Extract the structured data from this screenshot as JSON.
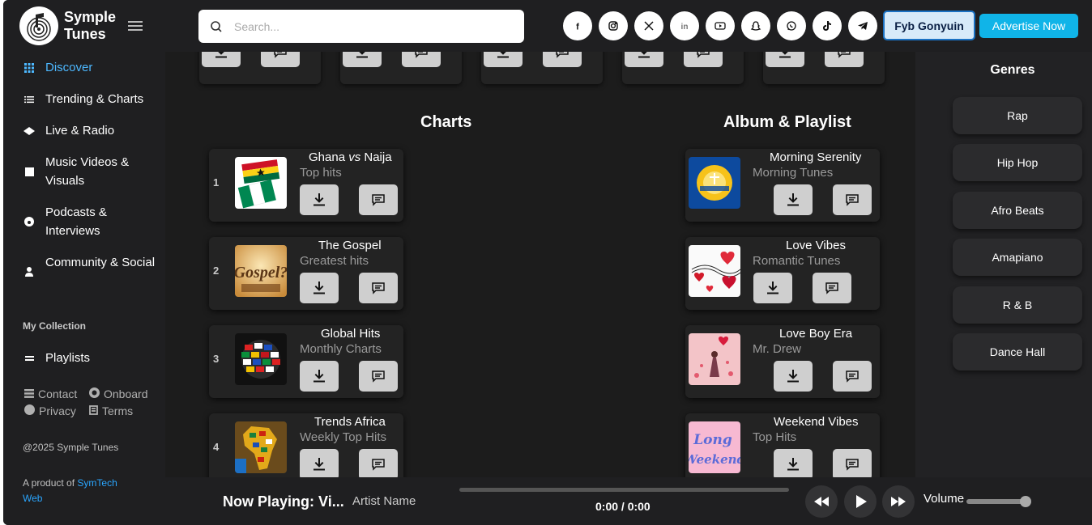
{
  "app": {
    "name": "Symple Tunes"
  },
  "sidebar": {
    "items": [
      {
        "label": "Discover",
        "icon": "grid-icon",
        "active": true
      },
      {
        "label": "Trending & Charts",
        "icon": "list-icon"
      },
      {
        "label": "Live & Radio",
        "icon": "broadcast-icon"
      },
      {
        "label": "Music Videos & Visuals",
        "icon": "video-icon"
      },
      {
        "label": "Podcasts & Interviews",
        "icon": "podcast-icon"
      },
      {
        "label": "Community & Social",
        "icon": "user-icon"
      }
    ],
    "collection_heading": "My Collection",
    "playlists_label": "Playlists",
    "footer_links": {
      "contact": "Contact",
      "onboard": "Onboard",
      "privacy": "Privacy",
      "terms": "Terms"
    },
    "copyright": "@2025 Symple Tunes",
    "product_prefix": "A product of ",
    "product_link": "SymTech Web"
  },
  "topbar": {
    "search_placeholder": "Search...",
    "socials": [
      "facebook-icon",
      "instagram-icon",
      "x-icon",
      "linkedin-icon",
      "youtube-icon",
      "snapchat-icon",
      "whatsapp-icon",
      "tiktok-icon",
      "telegram-icon"
    ],
    "user_button": "Fyb Gonyuin",
    "advertise_button": "Advertise Now"
  },
  "charts": {
    "title": "Charts",
    "items": [
      {
        "rank": "1",
        "title_a": "Ghana ",
        "title_vs": "vs",
        "title_b": " Naija",
        "subtitle": "Top hits"
      },
      {
        "rank": "2",
        "title": "The Gospel",
        "subtitle": "Greatest hits"
      },
      {
        "rank": "3",
        "title": "Global Hits",
        "subtitle": "Monthly Charts"
      },
      {
        "rank": "4",
        "title": "Trends Africa",
        "subtitle": "Weekly Top Hits"
      }
    ]
  },
  "albums": {
    "title": "Album & Playlist",
    "items": [
      {
        "title": "Morning Serenity",
        "subtitle": "Morning Tunes"
      },
      {
        "title": "Love Vibes",
        "subtitle": "Romantic Tunes"
      },
      {
        "title": "Love Boy Era",
        "subtitle": "Mr. Drew"
      },
      {
        "title": "Weekend Vibes",
        "subtitle": "Top Hits"
      }
    ]
  },
  "genres": {
    "title": "Genres",
    "items": [
      "Rap",
      "Hip Hop",
      "Afro Beats",
      "Amapiano",
      "R & B",
      "Dance Hall"
    ]
  },
  "player": {
    "now_playing": "Now Playing: Vi...",
    "artist": "Artist Name",
    "time": "0:00 / 0:00",
    "progress": 0,
    "volume_label": "Volume",
    "volume": 1.0
  },
  "colors": {
    "accent": "#10b4e8",
    "active_nav": "#4db8ff",
    "link": "#2aa6ff"
  }
}
